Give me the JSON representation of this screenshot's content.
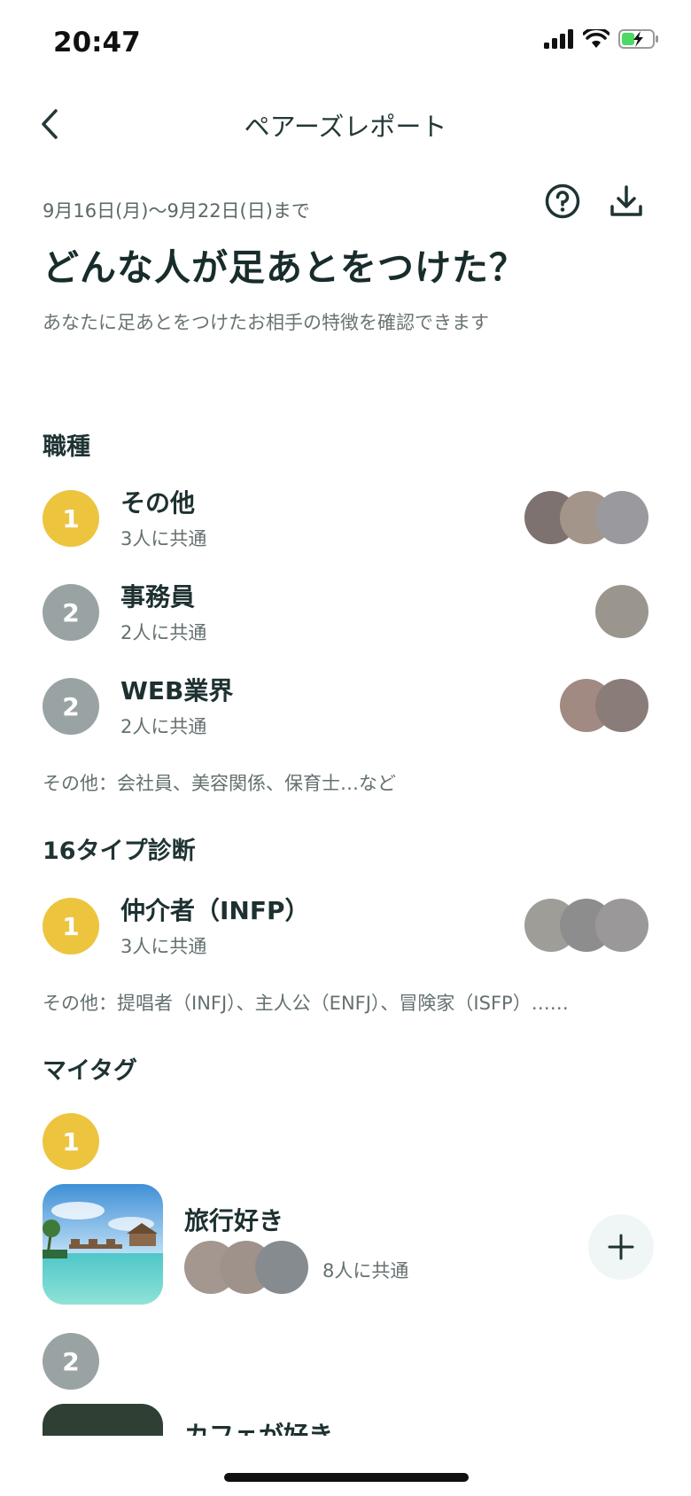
{
  "status": {
    "time": "20:47"
  },
  "nav": {
    "title": "ペアーズレポート"
  },
  "header": {
    "period": "9月16日(月)〜9月22日(日)まで",
    "headline": "どんな人が足あとをつけた？",
    "subtitle": "あなたに足あとをつけたお相手の特徴を確認できます"
  },
  "occupation": {
    "title": "職種",
    "items": [
      {
        "rank": "1",
        "name": "その他",
        "count": "3人に共通",
        "avatars": [
          "#7d7270",
          "#a39589",
          "#9a9a9e"
        ]
      },
      {
        "rank": "2",
        "name": "事務員",
        "count": "2人に共通",
        "avatars": [
          "#9a968e"
        ]
      },
      {
        "rank": "2",
        "name": "WEB業界",
        "count": "2人に共通",
        "avatars": [
          "#a08a82",
          "#8a7c78"
        ]
      }
    ],
    "others": "その他：会社員、美容関係、保育士…など"
  },
  "mbti": {
    "title": "16タイプ診断",
    "items": [
      {
        "rank": "1",
        "name": "仲介者（INFP）",
        "count": "3人に共通",
        "avatars": [
          "#9e9d98",
          "#8e8d8e",
          "#9a9899"
        ]
      }
    ],
    "others": "その他：提唱者（INFJ）、主人公（ENFJ）、冒険家（ISFP）……"
  },
  "mytag": {
    "title": "マイタグ",
    "items": [
      {
        "rank": "1",
        "name": "旅行好き",
        "count": "8人に共通",
        "avatars": [
          "#a4978f",
          "#9e928a",
          "#858b8f"
        ]
      },
      {
        "rank": "2",
        "name": "カフェが好き",
        "count": "",
        "avatars": []
      }
    ]
  },
  "colors": {
    "gold": "#ecc43e",
    "grey": "#9aa3a3",
    "battery": "#4cd964"
  }
}
